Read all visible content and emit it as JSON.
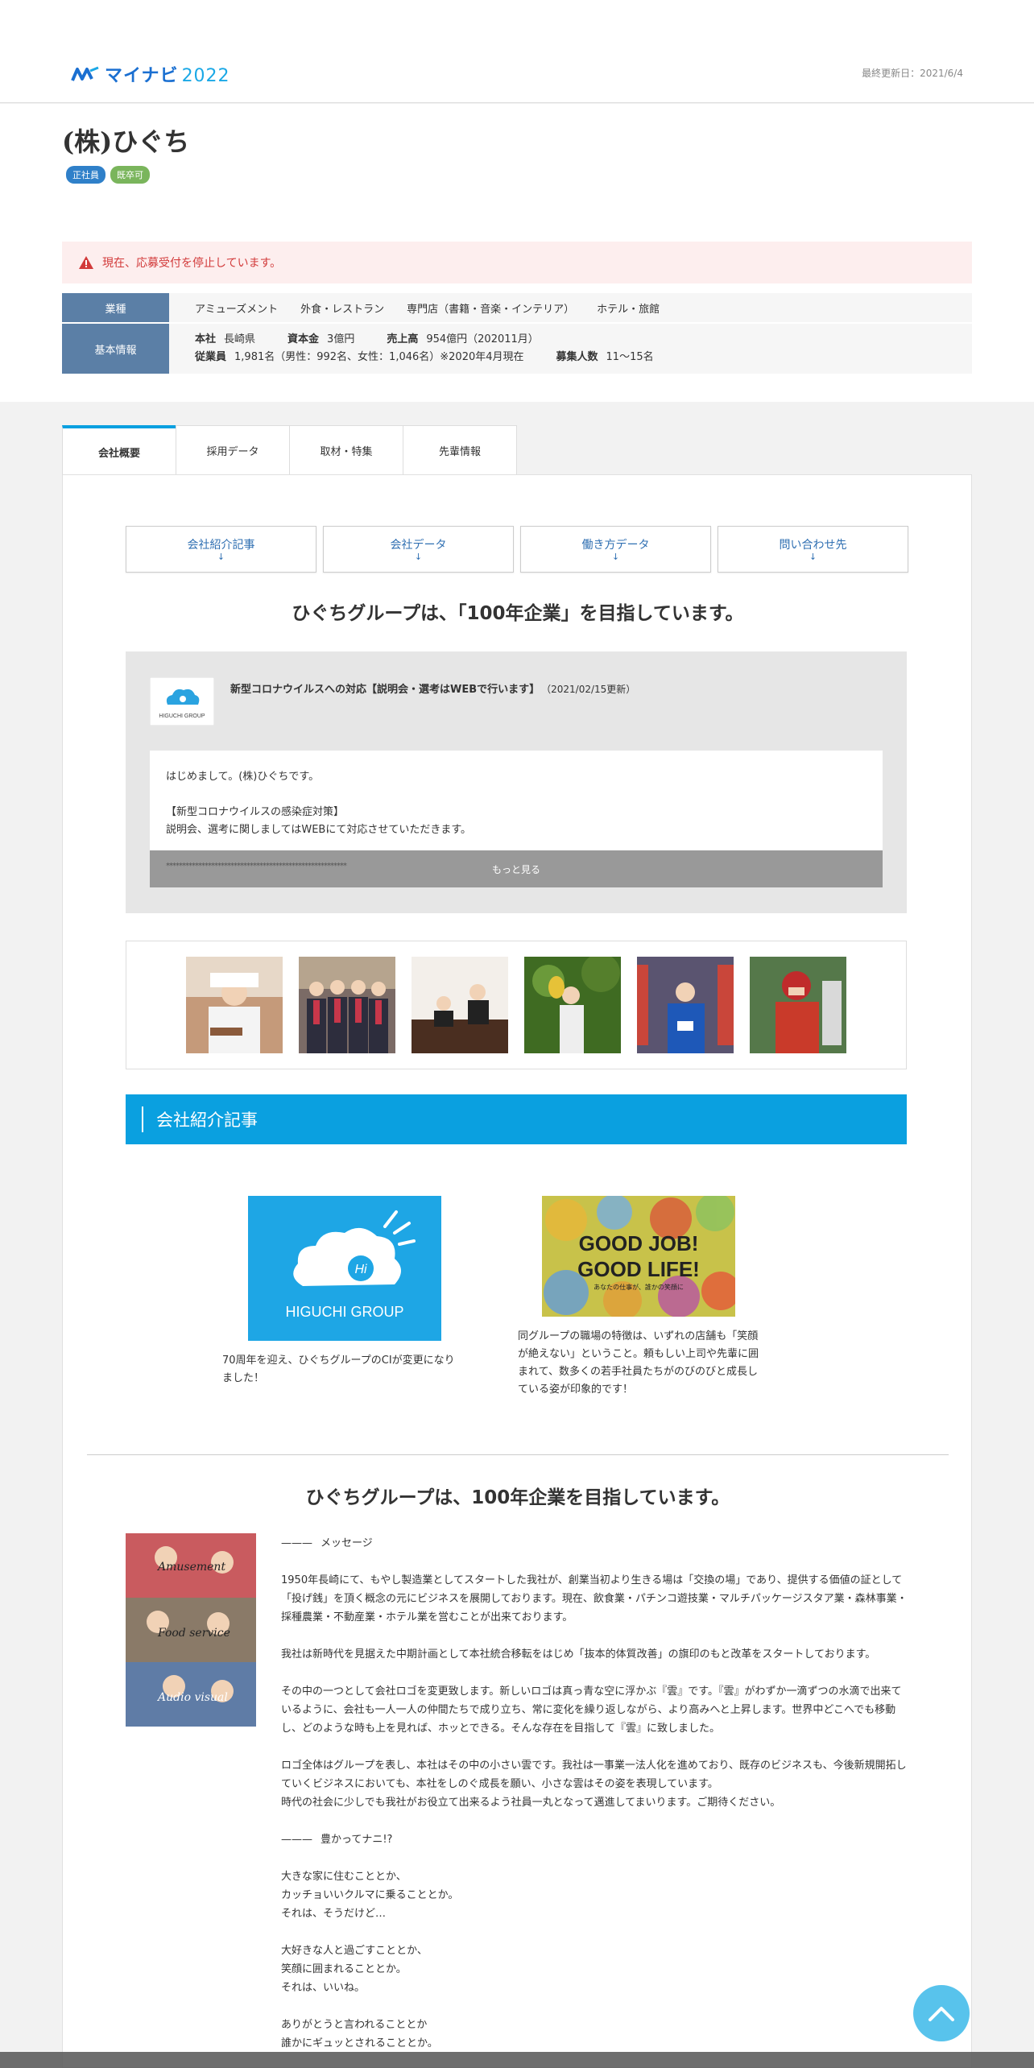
{
  "header": {
    "logo_text": "マイナビ",
    "logo_year": "2022",
    "updated": "最終更新日：2021/6/4"
  },
  "company": {
    "name": "(株)ひぐち",
    "badges": [
      "正社員",
      "既卒可"
    ]
  },
  "alert": {
    "text": "現在、応募受付を停止しています。"
  },
  "info": {
    "industry_label": "業種",
    "industries": [
      "アミューズメント",
      "外食・レストラン",
      "専門店（書籍・音楽・インテリア）",
      "ホテル・旅館"
    ],
    "basic_label": "基本情報",
    "hq_label": "本社",
    "hq": "長崎県",
    "capital_label": "資本金",
    "capital": "3億円",
    "sales_label": "売上高",
    "sales": "954億円（202011月）",
    "employees_label": "従業員",
    "employees": "1,981名（男性：992名、女性：1,046名）※2020年4月現在",
    "hiring_label": "募集人数",
    "hiring": "11～15名"
  },
  "tabs": [
    "会社概要",
    "採用データ",
    "取材・特集",
    "先輩情報"
  ],
  "anchors": [
    {
      "label": "会社紹介記事",
      "arrow": "↓"
    },
    {
      "label": "会社データ",
      "arrow": "↓"
    },
    {
      "label": "働き方データ",
      "arrow": "↓"
    },
    {
      "label": "問い合わせ先",
      "arrow": "↓"
    }
  ],
  "catch": "ひぐちグループは、「100年企業」を目指しています。",
  "news": {
    "logo_caption": "HIGUCHI GROUP",
    "title": "新型コロナウイルスへの対応【説明会・選考はWEBで行います】",
    "date": "（2021/02/15更新）",
    "line1": "はじめまして。(株)ひぐちです。",
    "line2": "【新型コロナウイルスの感染症対策】",
    "line3": "説明会、選考に関しましてはWEBにて対応させていただきます。",
    "stars": "********************************************************",
    "more": "もっと見る"
  },
  "section_title": "会社紹介記事",
  "articles": [
    {
      "logo_text": "HIGUCHI GROUP",
      "badge": "Hi",
      "caption": "70周年を迎え、ひぐちグループのCIが変更になりました！"
    },
    {
      "banner_line1": "GOOD JOB!",
      "banner_line2": "GOOD LIFE!",
      "banner_sub": "あなたの仕事が、誰かの笑顔に",
      "caption": "同グループの職場の特徴は、いずれの店舗も「笑顔が絶えない」ということ。頼もしい上司や先輩に囲まれて、数多くの若手社員たちがのびのびと成長している姿が印象的です！"
    }
  ],
  "catch2": "ひぐちグループは、100年企業を目指しています。",
  "message": {
    "collage_labels": [
      "Amusement",
      "Food service",
      "Audio visual"
    ],
    "heading1_dash": "———",
    "heading1": "メッセージ",
    "p1": "1950年長崎にて、もやし製造業としてスタートした我社が、創業当初より生きる場は「交換の場」であり、提供する価値の証として「投げ銭」を頂く概念の元にビジネスを展開しております。現在、飲食業・パチンコ遊技業・マルチパッケージスタア業・森林事業・採種農業・不動産業・ホテル業を営むことが出来ております。",
    "p2": "我社は新時代を見据えた中期計画として本社統合移転をはじめ「抜本的体質改善」の旗印のもと改革をスタートしております。",
    "p3": "その中の一つとして会社ロゴを変更致します。新しいロゴは真っ青な空に浮かぶ『雲』です。『雲』がわずか一滴ずつの水滴で出来ているように、会社も一人一人の仲間たちで成り立ち、常に変化を繰り返しながら、より高みへと上昇します。世界中どこへでも移動し、どのような時も上を見れば、ホッとできる。そんな存在を目指して『雲』に致しました。",
    "p4a": "ロゴ全体はグループを表し、本社はその中の小さい雲です。我社は一事業一法人化を進めており、既存のビジネスも、今後新規開拓していくビジネスにおいても、本社をしのぐ成長を願い、小さな雲はその姿を表現しています。",
    "p4b": "時代の社会に少しでも我社がお役立て出来るよう社員一丸となって邁進してまいります。ご期待ください。",
    "heading2_dash": "———",
    "heading2": "豊かってナニ!?",
    "v1": "大きな家に住むこととか、",
    "v2": "カッチョいいクルマに乗ることとか。",
    "v3": "それは、そうだけど…",
    "v4": "大好きな人と過ごすこととか、",
    "v5": "笑顔に囲まれることとか。",
    "v6": "それは、いいね。",
    "v7": "ありがとうと言われることとか",
    "v8": "誰かにギュッとされることとか。"
  },
  "colors": {
    "accent": "#0aa0e0",
    "label_bg": "#5b7fa6",
    "alert": "#d23a3a"
  }
}
